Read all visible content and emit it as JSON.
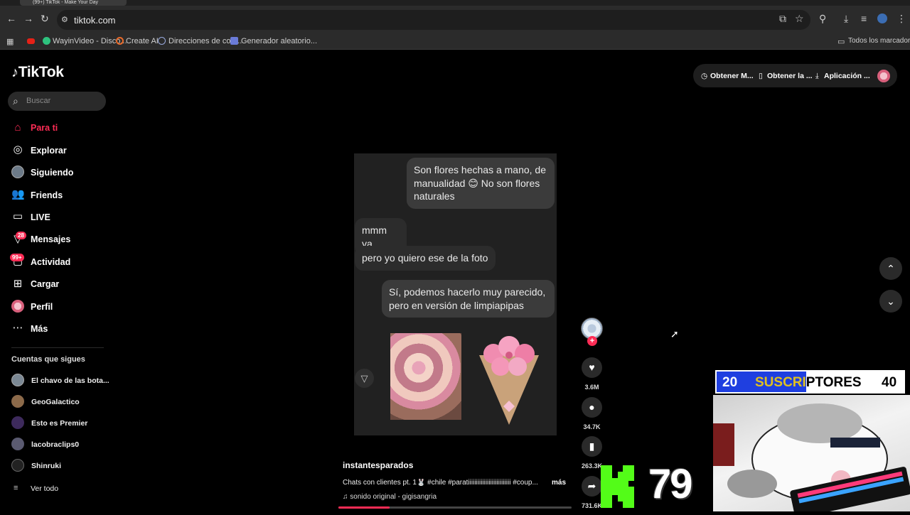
{
  "browser": {
    "tab_title": "(99+) TikTok - Make Your Day",
    "url": "tiktok.com",
    "bookmarks": [
      "WayinVideo - Disco...",
      "Create AI",
      "Direcciones de corr...",
      "Generador aleatorio..."
    ],
    "all_bookmarks": "Todos los marcadores"
  },
  "sidebar": {
    "logo": "TikTok",
    "search_placeholder": "Buscar",
    "nav": [
      {
        "label": "Para ti",
        "icon": "home-icon",
        "active": true
      },
      {
        "label": "Explorar",
        "icon": "compass-icon"
      },
      {
        "label": "Siguiendo",
        "icon": "following-avatar-icon"
      },
      {
        "label": "Friends",
        "icon": "friends-icon"
      },
      {
        "label": "LIVE",
        "icon": "live-icon"
      },
      {
        "label": "Mensajes",
        "icon": "messages-icon",
        "badge": "28"
      },
      {
        "label": "Actividad",
        "icon": "activity-icon",
        "badge": "99+"
      },
      {
        "label": "Cargar",
        "icon": "upload-icon"
      },
      {
        "label": "Perfil",
        "icon": "profile-avatar-icon"
      },
      {
        "label": "Más",
        "icon": "more-icon"
      }
    ],
    "following_header": "Cuentas que sigues",
    "following": [
      "El chavo de las bota...",
      "GeoGalactico",
      "Esto es Premier",
      "lacobraclips0",
      "Shinruki"
    ],
    "see_all": "Ver todo"
  },
  "topbar": {
    "buttons": [
      "Obtener M...",
      "Obtener la ...",
      "Aplicación ..."
    ]
  },
  "video": {
    "messages": [
      {
        "from": "me",
        "text": "Son flores hechas a mano, de manualidad 😊 No son flores naturales"
      },
      {
        "from": "them",
        "text": "mmm ya"
      },
      {
        "from": "them",
        "text": "pero yo quiero ese de la foto"
      },
      {
        "from": "me",
        "text": "Sí, podemos hacerlo muy parecido, pero en versión de limpiapipas"
      }
    ],
    "progress": 0.22
  },
  "actions": {
    "likes": "3.6M",
    "comments": "34.7K",
    "saves": "263.3K",
    "shares": "731.6K"
  },
  "post": {
    "username": "instantesparados",
    "caption": "Chats con clientes pt. 1🐰 #chile #paratiiiiiiiiiiiiiiiiiiiiiiiiiii #coup...",
    "more": "más",
    "sound": "sonido original - gigisangria"
  },
  "overlay": {
    "sub_current": "20",
    "sub_label": "SUSCRIPTORES",
    "sub_goal": "40",
    "kick_count": "79"
  },
  "colors": {
    "accent": "#fe2c55",
    "subbar_blue": "#1f3fe0",
    "kick_green": "#53fc18"
  }
}
